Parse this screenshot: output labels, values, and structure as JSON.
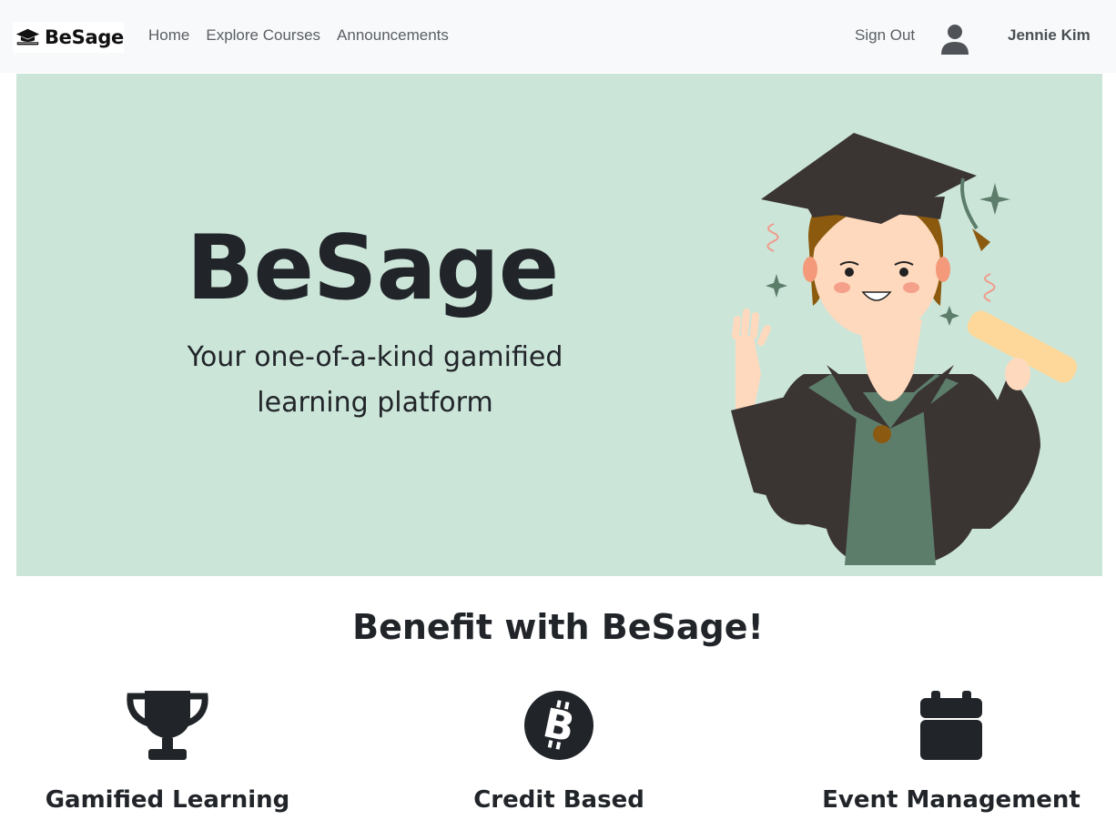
{
  "navbar": {
    "brand_text": "BeSage",
    "links": [
      "Home",
      "Explore Courses",
      "Announcements"
    ],
    "sign_out": "Sign Out",
    "user_name": "Jennie Kim",
    "user_icon": "user-icon",
    "background": "#f8f9fa"
  },
  "hero": {
    "title": "BeSage",
    "subtitle_line1": "Your one-of-a-kind gamified",
    "subtitle_line2": "learning platform",
    "background": "#cce5d9",
    "illustration": "graduate-illustration"
  },
  "benefits": {
    "heading": "Benefit with BeSage!",
    "items": [
      {
        "icon": "trophy-icon",
        "title": "Gamified Learning"
      },
      {
        "icon": "bitcoin-icon",
        "title": "Credit Based"
      },
      {
        "icon": "calendar-icon",
        "title": "Event Management"
      }
    ]
  }
}
